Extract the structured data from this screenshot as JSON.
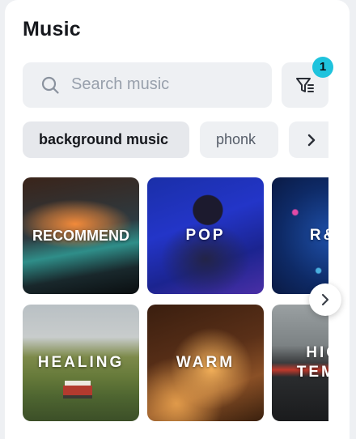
{
  "header": {
    "title": "Music"
  },
  "search": {
    "placeholder": "Search music",
    "icon": "search-icon"
  },
  "filter": {
    "icon": "filter-icon",
    "badge_count": "1",
    "badge_color": "#1fc3dd"
  },
  "tags": [
    {
      "label": "background music",
      "selected": true
    },
    {
      "label": "phonk",
      "selected": false
    }
  ],
  "tags_more_icon": "chevron-right-icon",
  "genres": [
    {
      "label": "RECOMMEND"
    },
    {
      "label": "POP"
    },
    {
      "label": "R&B"
    },
    {
      "label": "HEALING"
    },
    {
      "label": "WARM"
    },
    {
      "label": "HIGH TEMPO"
    }
  ],
  "carousel_next_icon": "chevron-right-icon"
}
